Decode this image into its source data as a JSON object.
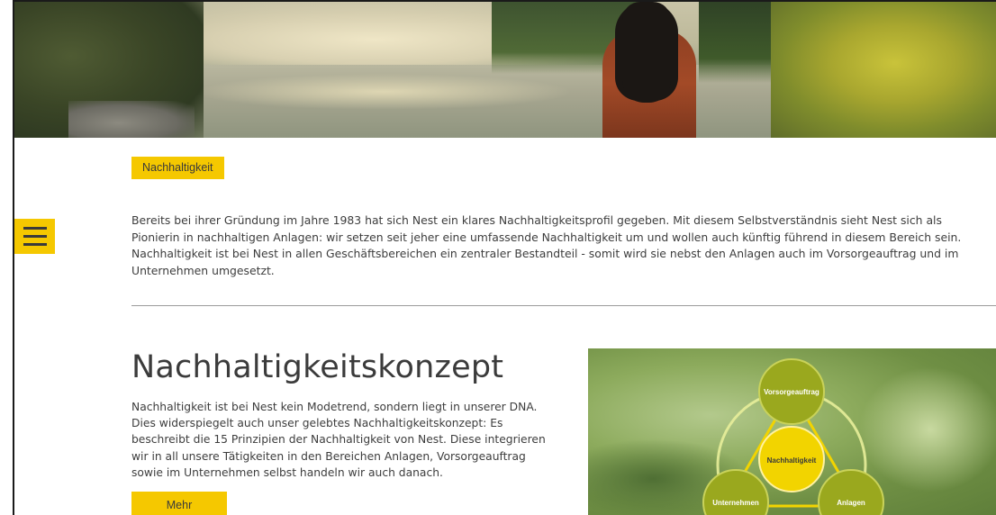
{
  "hero": {
    "alt": "Frau am nebligen See im Wald"
  },
  "menu": {
    "icon": "hamburger-menu-icon"
  },
  "tag": {
    "label": "Nachhaltigkeit"
  },
  "intro": {
    "text": "Bereits bei ihrer Gründung im Jahre 1983 hat sich Nest ein klares Nachhaltigkeitsprofil gegeben. Mit diesem Selbstverständnis sieht Nest sich als Pionierin in nachhaltigen Anlagen: wir setzen seit jeher eine umfassende Nachhaltigkeit um und wollen auch künftig führend in diesem Bereich sein. Nachhaltigkeit ist bei Nest in allen Geschäftsbereichen ein zentraler Bestandteil - somit wird sie nebst den Anlagen auch im Vorsorgeauftrag und im Unternehmen umgesetzt."
  },
  "concept": {
    "title": "Nachhaltigkeitskonzept",
    "text": "Nachhaltigkeit ist bei Nest kein Modetrend, sondern liegt in unserer DNA. Dies widerspiegelt auch unser gelebtes Nachhaltigkeitskonzept: Es beschreibt die 15 Prinzipien der Nachhaltigkeit von Nest. Diese integrieren wir in all unsere Tätigkeiten in den Bereichen Anlagen, Vorsorgeauftrag sowie im Unternehmen selbst handeln wir auch danach.",
    "more_label": "Mehr"
  },
  "diagram": {
    "center": "Nachhaltigkeit",
    "top": "Vorsorgeauftrag",
    "left": "Unternehmen",
    "right": "Anlagen"
  },
  "colors": {
    "accent": "#f5c800",
    "text": "#3d3d3d",
    "node_green": "#9aa81e",
    "node_yellow": "#f2d400"
  }
}
